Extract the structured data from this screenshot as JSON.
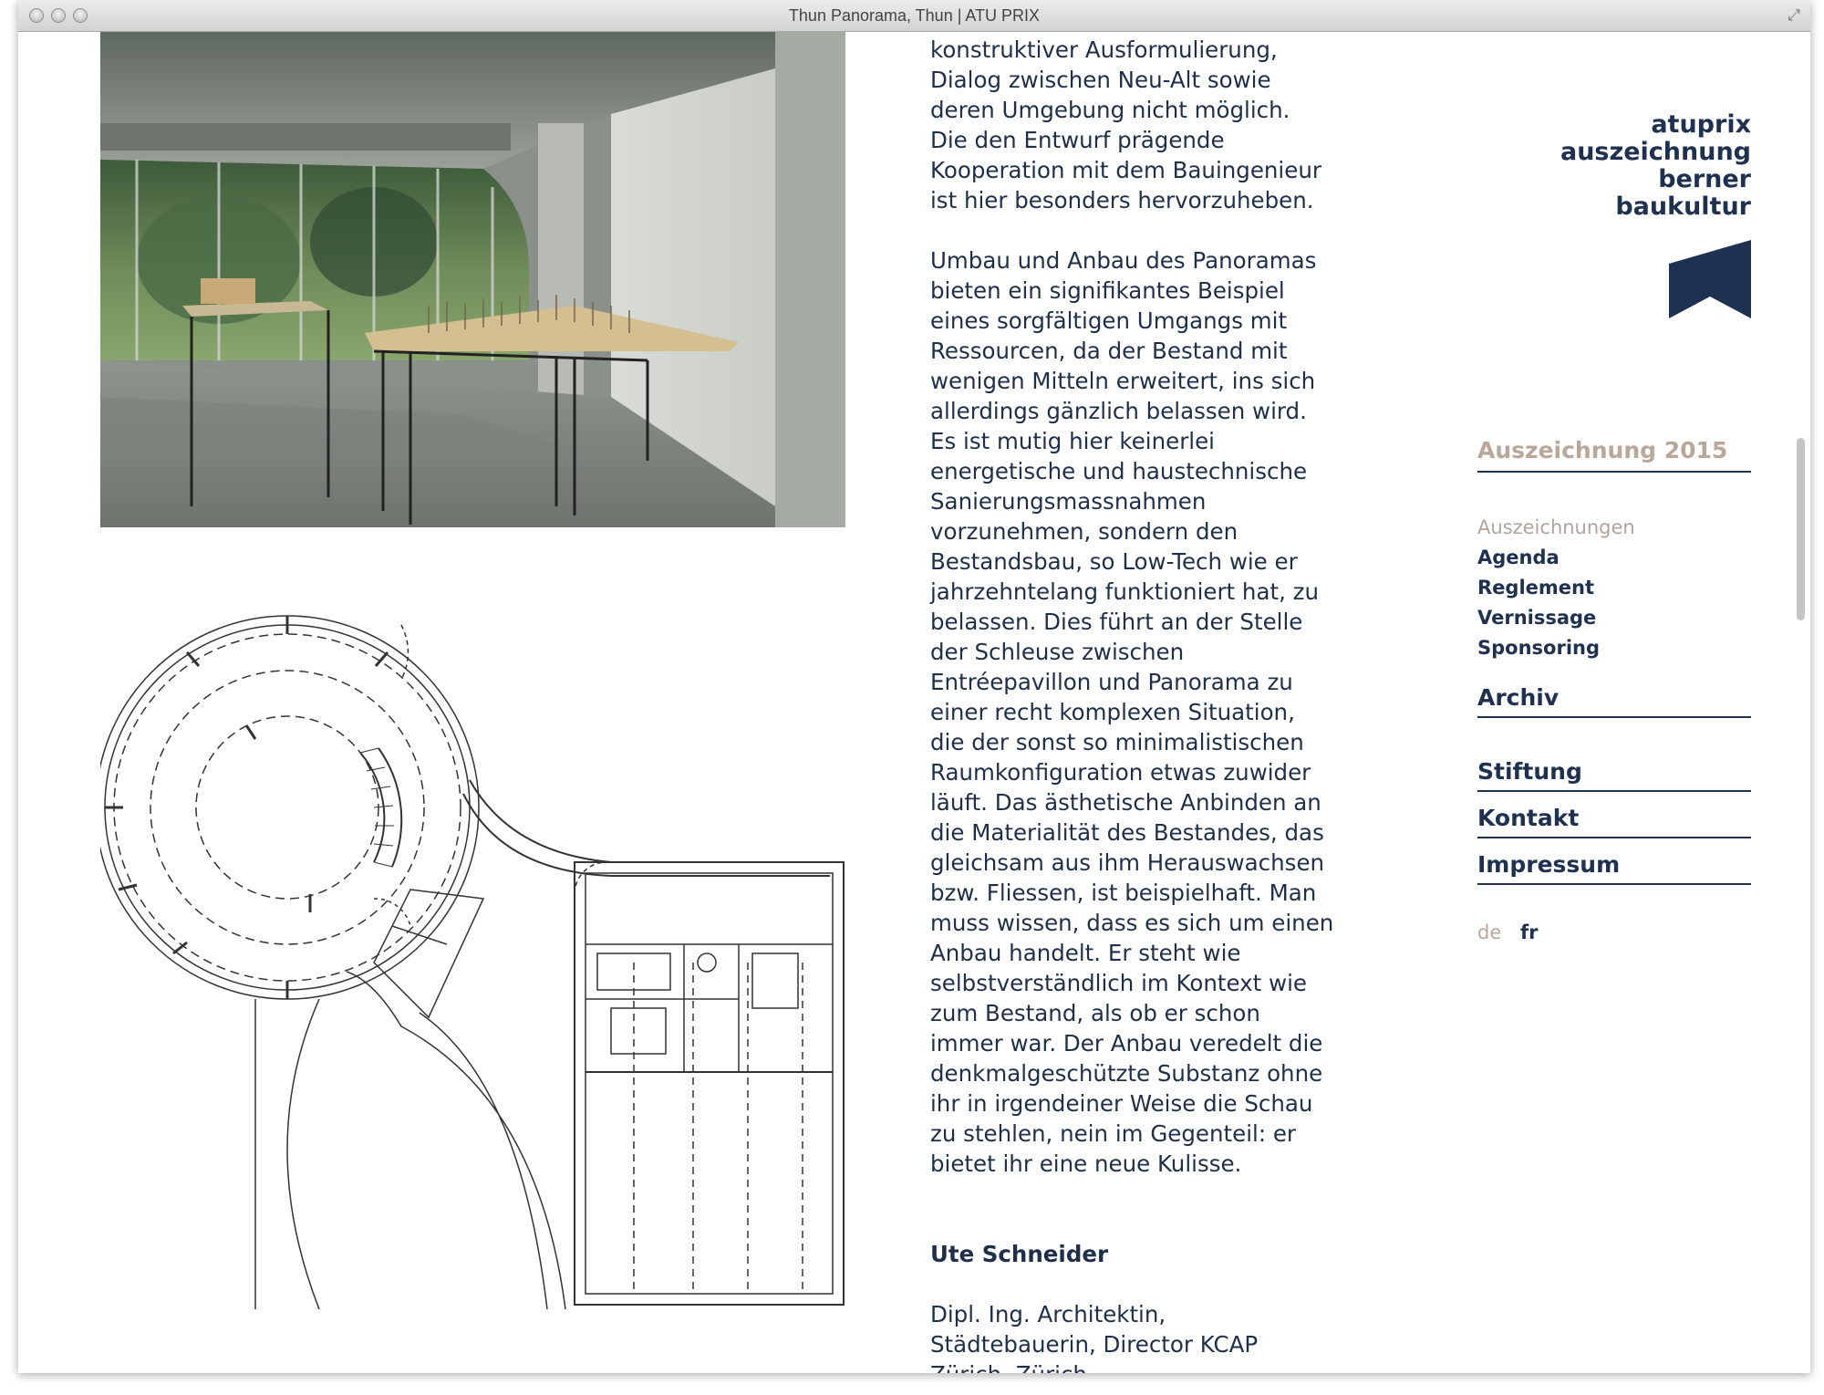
{
  "window": {
    "title": "Thun Panorama, Thun | ATU PRIX"
  },
  "article": {
    "paragraphs": [
      "konstruktiver Ausformulierung,\nDialog zwischen Neu-Alt sowie\nderen Umgebung nicht möglich.\nDie den Entwurf prägende\nKooperation mit dem Bauingenieur\nist hier besonders hervorzuheben.",
      "Umbau und Anbau des Panoramas\nbieten ein signifikantes Beispiel\neines sorgfältigen Umgangs mit\nRessourcen, da der Bestand mit\nwenigen Mitteln erweitert, ins sich\nallerdings gänzlich belassen wird.\nEs ist mutig hier keinerlei\nenergetische und haustechnische\nSanierungsmassnahmen\nvorzunehmen, sondern den\nBestandsbau, so Low-Tech wie er\njahrzehntelang funktioniert hat, zu\nbelassen. Dies führt an der Stelle\nder Schleuse zwischen\nEntréepavillon und Panorama zu\neiner recht komplexen Situation,\ndie der sonst so minimalistischen\nRaumkonfiguration etwas zuwider\nläuft. Das ästhetische Anbinden an\ndie Materialität des Bestandes, das\ngleichsam aus ihm Herauswachsen\nbzw. Fliessen, ist beispielhaft. Man\nmuss wissen, dass es sich um einen\nAnbau handelt. Er steht wie\nselbstverständlich im Kontext wie\nzum Bestand, als ob er schon\nimmer war. Der Anbau veredelt die\ndenkmalgeschützte Substanz ohne\nihr in irgendeiner Weise die Schau\nzu stehlen, nein im Gegenteil: er\nbietet ihr eine neue Kulisse."
    ],
    "author_name": "Ute Schneider",
    "author_details": "Dipl. Ing. Architektin,\nStädtebauerin, Director KCAP\nZürich, Zürich"
  },
  "logo": {
    "lines": [
      "atuprix",
      "auszeichnung",
      "berner",
      "baukultur"
    ],
    "color": "#1f3150"
  },
  "nav": {
    "year_label": "Auszeichnung 2015",
    "subitems": [
      "Auszeichnungen",
      "Agenda",
      "Reglement",
      "Vernissage",
      "Sponsoring"
    ],
    "archiv": "Archiv",
    "stiftung": "Stiftung",
    "kontakt": "Kontakt",
    "impressum": "Impressum"
  },
  "lang": {
    "de": "de",
    "fr": "fr"
  },
  "colors": {
    "navy": "#1f3150",
    "muted": "#b9a89a"
  }
}
